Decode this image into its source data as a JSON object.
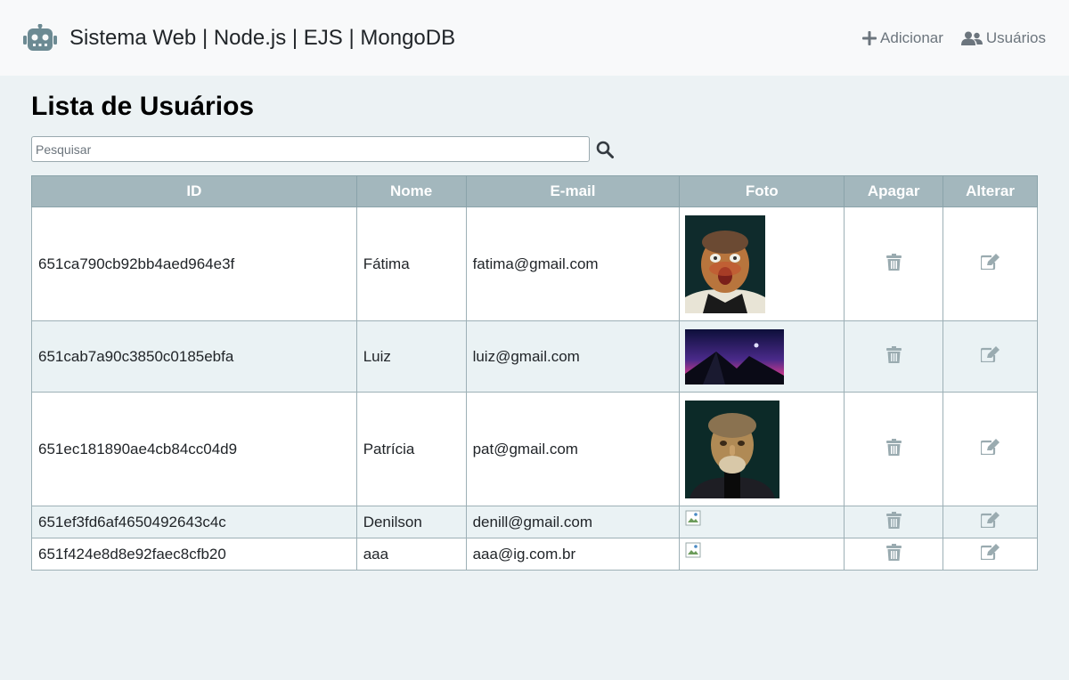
{
  "header": {
    "brand_icon": "robot-icon",
    "title": "Sistema Web | Node.js | EJS | MongoDB",
    "nav": [
      {
        "label": "Adicionar",
        "icon": "plus-icon"
      },
      {
        "label": "Usuários",
        "icon": "users-icon"
      }
    ]
  },
  "main": {
    "title": "Lista de Usuários",
    "search": {
      "placeholder": "Pesquisar",
      "value": "",
      "icon": "search-icon"
    },
    "table": {
      "columns": [
        "ID",
        "Nome",
        "E-mail",
        "Foto",
        "Apagar",
        "Alterar"
      ],
      "rows": [
        {
          "id": "651ca790cb92bb4aed964e3f",
          "nome": "Fátima",
          "email": "fatima@gmail.com",
          "foto": "portrait-photo"
        },
        {
          "id": "651cab7a90c3850c0185ebfa",
          "nome": "Luiz",
          "email": "luiz@gmail.com",
          "foto": "landscape-photo"
        },
        {
          "id": "651ec181890ae4cb84cc04d9",
          "nome": "Patrícia",
          "email": "pat@gmail.com",
          "foto": "portrait-photo"
        },
        {
          "id": "651ef3fd6af4650492643c4c",
          "nome": "Denilson",
          "email": "denill@gmail.com",
          "foto": "broken-image"
        },
        {
          "id": "651f424e8d8e92faec8cfb20",
          "nome": "aaa",
          "email": "aaa@ig.com.br",
          "foto": "broken-image"
        }
      ],
      "delete_icon": "trash-icon",
      "edit_icon": "edit-icon"
    }
  },
  "colors": {
    "accent": "#6c757d",
    "header_bg": "#a3b7bd",
    "icon": "#9aabb0"
  }
}
